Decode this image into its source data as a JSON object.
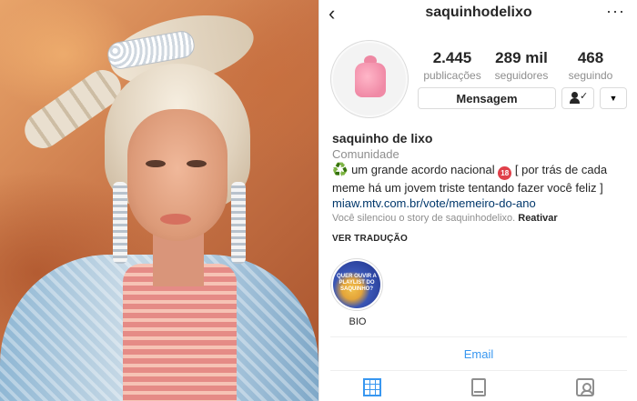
{
  "header": {
    "back_icon": "chevron-left-icon",
    "username": "saquinhodelixo",
    "more_icon": "ellipsis-icon"
  },
  "avatar": {
    "icon": "pink-trash-bag-icon"
  },
  "stats": [
    {
      "value": "2.445",
      "label": "publicações"
    },
    {
      "value": "289 mil",
      "label": "seguidores"
    },
    {
      "value": "468",
      "label": "seguindo"
    }
  ],
  "actions": {
    "message_label": "Mensagem",
    "following_icon": "person-check-icon",
    "dropdown_icon": "triangle-down-icon"
  },
  "bio": {
    "name": "saquinho de lixo",
    "category": "Comunidade",
    "recycle_glyph": "♻️",
    "line1_a": "um grande acordo nacional",
    "badge": "18",
    "line1_b": "[ por trás de cada meme há um jovem triste tentando fazer você feliz ]",
    "link": "miaw.mtv.com.br/vote/memeiro-do-ano",
    "muted_text": "Você silenciou o story de saquinhodelixo.",
    "muted_action": "Reativar",
    "translate": "VER TRADUÇÃO"
  },
  "highlights": [
    {
      "label": "BIO",
      "cover_text": "QUER OUVIR A PLAYLIST DO SAQUINHO?"
    }
  ],
  "contact": {
    "email_label": "Email"
  },
  "tabs": [
    {
      "name": "grid",
      "icon": "grid-icon",
      "active": true
    },
    {
      "name": "feed",
      "icon": "feed-icon",
      "active": false
    },
    {
      "name": "tagged",
      "icon": "tagged-icon",
      "active": false
    }
  ],
  "colors": {
    "link_blue": "#3897f0",
    "link_dark": "#00376b",
    "muted_gray": "#8e8e8e",
    "bag_pink": "#f08aa6"
  }
}
